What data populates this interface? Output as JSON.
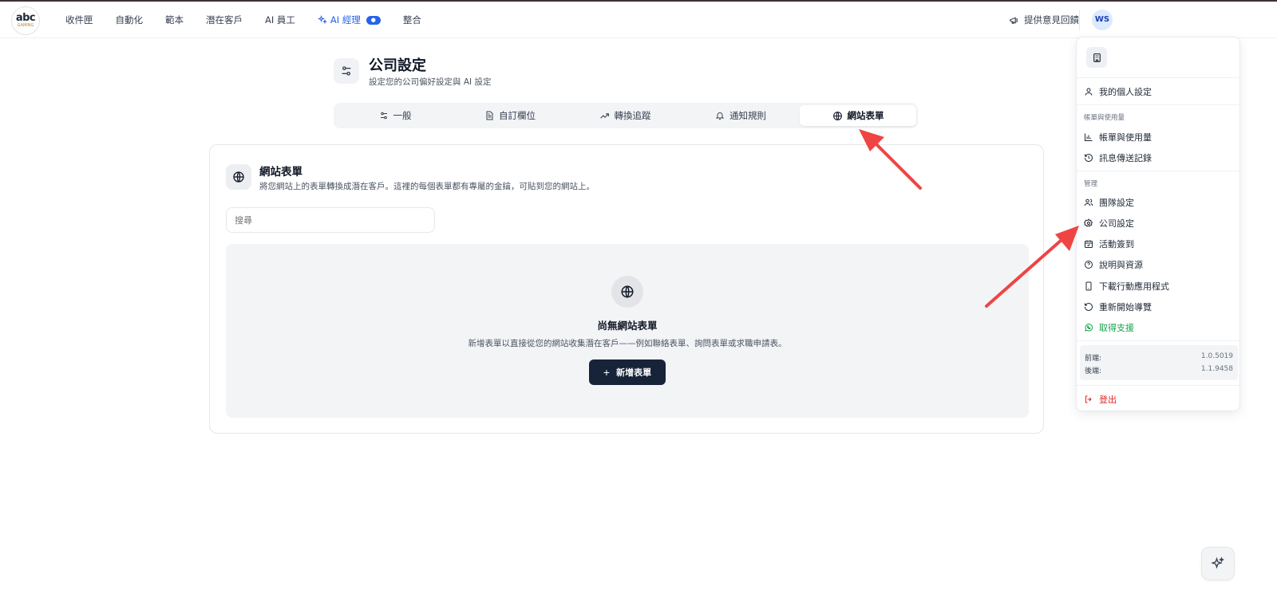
{
  "header": {
    "logo_main": "abc",
    "logo_sub": "GAMING",
    "nav": [
      "收件匣",
      "自動化",
      "範本",
      "潛在客戶",
      "AI 員工",
      "AI 經理",
      "整合"
    ],
    "feedback_label": "提供意見回饋",
    "avatar_initials": "WS"
  },
  "page": {
    "title": "公司設定",
    "subtitle": "設定您的公司偏好設定與 AI 設定"
  },
  "tabs": [
    {
      "label": "一般",
      "icon": "sliders-icon"
    },
    {
      "label": "自訂欄位",
      "icon": "document-icon"
    },
    {
      "label": "轉換追蹤",
      "icon": "trend-up-icon"
    },
    {
      "label": "通知規則",
      "icon": "bell-icon"
    },
    {
      "label": "網站表單",
      "icon": "globe-icon",
      "active": true
    }
  ],
  "card": {
    "title": "網站表單",
    "description": "將您網站上的表單轉換成潛在客戶。這裡的每個表單都有專屬的金鑰，可貼到您的網站上。",
    "search_placeholder": "搜尋",
    "empty_title": "尚無網站表單",
    "empty_desc": "新增表單以直接從您的網站收集潛在客戶——例如聯絡表單、詢問表單或求職申請表。",
    "add_button": "新增表單"
  },
  "menu": {
    "profile": "我的個人設定",
    "billing_section": "帳單與使用量",
    "billing": "帳單與使用量",
    "message_log": "訊息傳送記錄",
    "manage_section": "管理",
    "team": "團隊設定",
    "company": "公司設定",
    "checkin": "活動簽到",
    "help": "說明與資源",
    "download_app": "下載行動應用程式",
    "restart_tour": "重新開始導覽",
    "support": "取得支援",
    "frontend_label": "前端:",
    "frontend_version": "1.0.5019",
    "backend_label": "後端:",
    "backend_version": "1.1.9458",
    "logout": "登出"
  },
  "colors": {
    "accent_blue": "#2563eb",
    "primary_dark": "#172338",
    "arrow_red": "#ef4444",
    "support_green": "#16a34a",
    "logout_red": "#dc2626"
  }
}
